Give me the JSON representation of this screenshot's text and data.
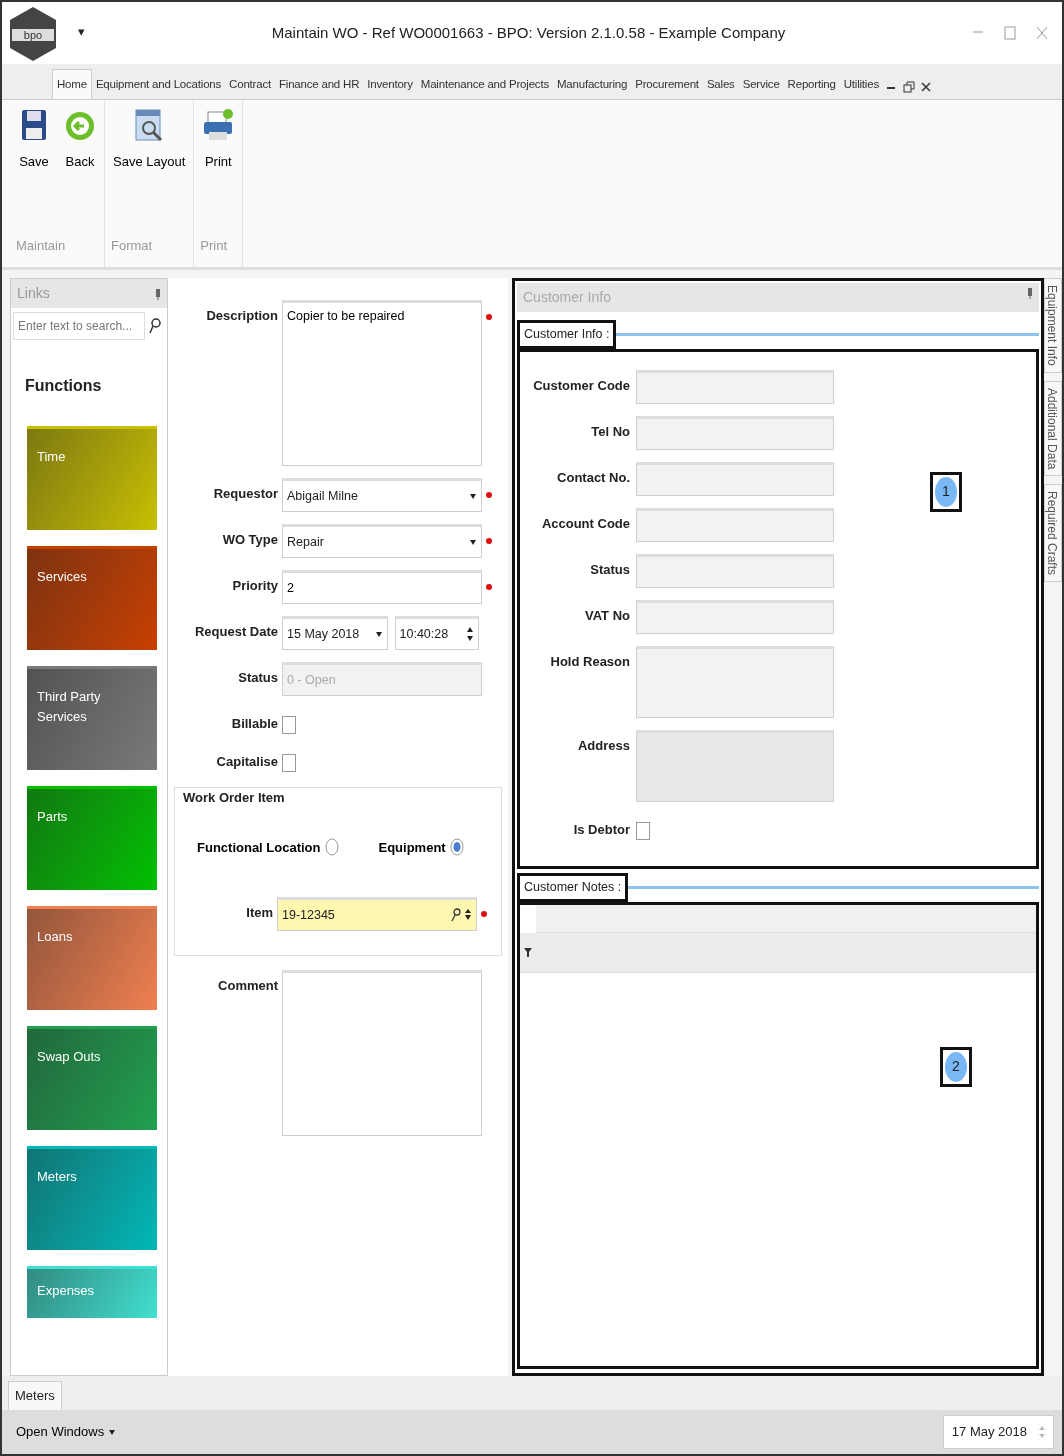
{
  "window": {
    "logo_text": "bpo",
    "quick_access": "▾",
    "title": "Maintain WO - Ref WO0001663 - BPO: Version 2.1.0.58 - Example Company"
  },
  "menu_tabs": [
    {
      "label": "Home",
      "selected": true
    },
    {
      "label": "Equipment and Locations",
      "selected": false
    },
    {
      "label": "Contract",
      "selected": false
    },
    {
      "label": "Finance and HR",
      "selected": false
    },
    {
      "label": "Inventory",
      "selected": false
    },
    {
      "label": "Maintenance and Projects",
      "selected": false
    },
    {
      "label": "Manufacturing",
      "selected": false
    },
    {
      "label": "Procurement",
      "selected": false
    },
    {
      "label": "Sales",
      "selected": false
    },
    {
      "label": "Service",
      "selected": false
    },
    {
      "label": "Reporting",
      "selected": false
    },
    {
      "label": "Utilities",
      "selected": false
    }
  ],
  "ribbon": [
    {
      "label": "Maintain",
      "buttons": [
        {
          "label": "Save",
          "kind": "save"
        },
        {
          "label": "Back",
          "kind": "back"
        }
      ]
    },
    {
      "label": "Format",
      "buttons": [
        {
          "label": "Save Layout",
          "kind": "layout"
        }
      ]
    },
    {
      "label": "Print",
      "buttons": [
        {
          "label": "Print",
          "kind": "print"
        }
      ]
    }
  ],
  "links_panel": {
    "title": "Links",
    "search": {
      "placeholder": "Enter text to search..."
    },
    "heading": "Functions",
    "tiles": [
      {
        "label": "Time",
        "color": "#c8c000"
      },
      {
        "label": "Services",
        "color": "#c84000"
      },
      {
        "label": "Third Party Services",
        "color": "#7a7a7a"
      },
      {
        "label": "Parts",
        "color": "#00c000"
      },
      {
        "label": "Loans",
        "color": "#f08050"
      },
      {
        "label": "Swap Outs",
        "color": "#20a050"
      },
      {
        "label": "Meters",
        "color": "#00b8b8"
      },
      {
        "label": "Expenses",
        "color": "#40e0d0"
      }
    ]
  },
  "form": {
    "fields": [
      {
        "label": "Description",
        "kind": "textarea",
        "value": "Copier to be repaired",
        "required": true
      },
      {
        "label": "Requestor",
        "kind": "select",
        "value": "Abigail Milne",
        "required": true
      },
      {
        "label": "WO Type",
        "kind": "select",
        "value": "Repair",
        "required": true
      },
      {
        "label": "Priority",
        "kind": "text",
        "value": "2",
        "required": true,
        "disabled": false
      },
      {
        "label": "Request Date",
        "kind": "datetime",
        "value": "15 May 2018",
        "time": "10:40:28",
        "required": false
      },
      {
        "label": "Status",
        "kind": "text",
        "value": "0 - Open",
        "required": false,
        "disabled": true
      },
      {
        "label": "Billable",
        "kind": "checkbox",
        "checked": false
      },
      {
        "label": "Capitalise",
        "kind": "checkbox",
        "checked": false
      }
    ]
  },
  "work_order_item": {
    "title": "Work Order Item",
    "radios": [
      {
        "label": "Functional Location",
        "selected": false
      },
      {
        "label": "Equipment",
        "selected": true
      }
    ],
    "item": {
      "label": "Item",
      "value": "19-12345",
      "required": true
    }
  },
  "comment": {
    "label": "Comment"
  },
  "customer_panel": {
    "title": "Customer Info",
    "customer_info": {
      "title": "Customer Info :",
      "callout": "1",
      "fields": [
        {
          "label": "Customer Code",
          "kind": "text"
        },
        {
          "label": "Tel No",
          "kind": "text"
        },
        {
          "label": "Contact No.",
          "kind": "text"
        },
        {
          "label": "Account Code",
          "kind": "text"
        },
        {
          "label": "Status",
          "kind": "text"
        },
        {
          "label": "VAT No",
          "kind": "text"
        },
        {
          "label": "Hold Reason",
          "kind": "textarea"
        },
        {
          "label": "Address",
          "kind": "textarea"
        },
        {
          "label": "Is Debtor",
          "kind": "checkbox",
          "checked": false
        }
      ]
    },
    "customer_notes": {
      "title": "Customer Notes :",
      "callout": "2"
    }
  },
  "side_tabs": [
    {
      "label": "Equipment Info"
    },
    {
      "label": "Additional Data"
    },
    {
      "label": "Required Crafts"
    }
  ],
  "bottom_tabs": [
    {
      "label": "Meters",
      "selected": true
    }
  ],
  "status_bar": {
    "open_windows": "Open Windows",
    "date": "17 May 2018"
  }
}
